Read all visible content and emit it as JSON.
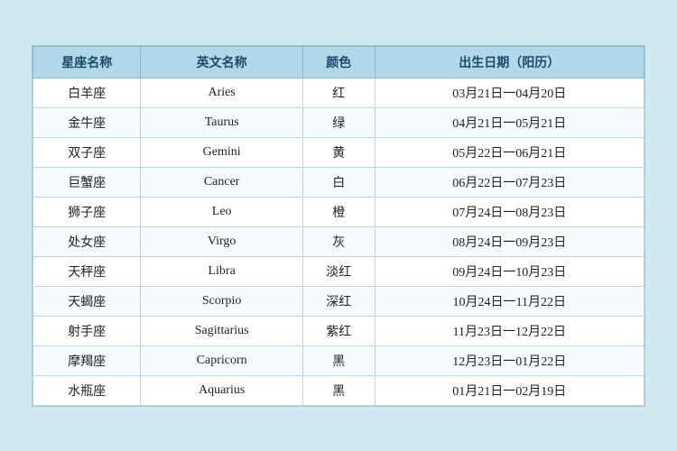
{
  "table": {
    "headers": [
      "星座名称",
      "英文名称",
      "颜色",
      "出生日期（阳历）"
    ],
    "rows": [
      {
        "chinese": "白羊座",
        "english": "Aries",
        "color": "红",
        "date": "03月21日一04月20日"
      },
      {
        "chinese": "金牛座",
        "english": "Taurus",
        "color": "绿",
        "date": "04月21日一05月21日"
      },
      {
        "chinese": "双子座",
        "english": "Gemini",
        "color": "黄",
        "date": "05月22日一06月21日"
      },
      {
        "chinese": "巨蟹座",
        "english": "Cancer",
        "color": "白",
        "date": "06月22日一07月23日"
      },
      {
        "chinese": "狮子座",
        "english": "Leo",
        "color": "橙",
        "date": "07月24日一08月23日"
      },
      {
        "chinese": "处女座",
        "english": "Virgo",
        "color": "灰",
        "date": "08月24日一09月23日"
      },
      {
        "chinese": "天秤座",
        "english": "Libra",
        "color": "淡红",
        "date": "09月24日一10月23日"
      },
      {
        "chinese": "天蝎座",
        "english": "Scorpio",
        "color": "深红",
        "date": "10月24日一11月22日"
      },
      {
        "chinese": "射手座",
        "english": "Sagittarius",
        "color": "紫红",
        "date": "11月23日一12月22日"
      },
      {
        "chinese": "摩羯座",
        "english": "Capricorn",
        "color": "黑",
        "date": "12月23日一01月22日"
      },
      {
        "chinese": "水瓶座",
        "english": "Aquarius",
        "color": "黑",
        "date": "01月21日一02月19日"
      }
    ]
  }
}
